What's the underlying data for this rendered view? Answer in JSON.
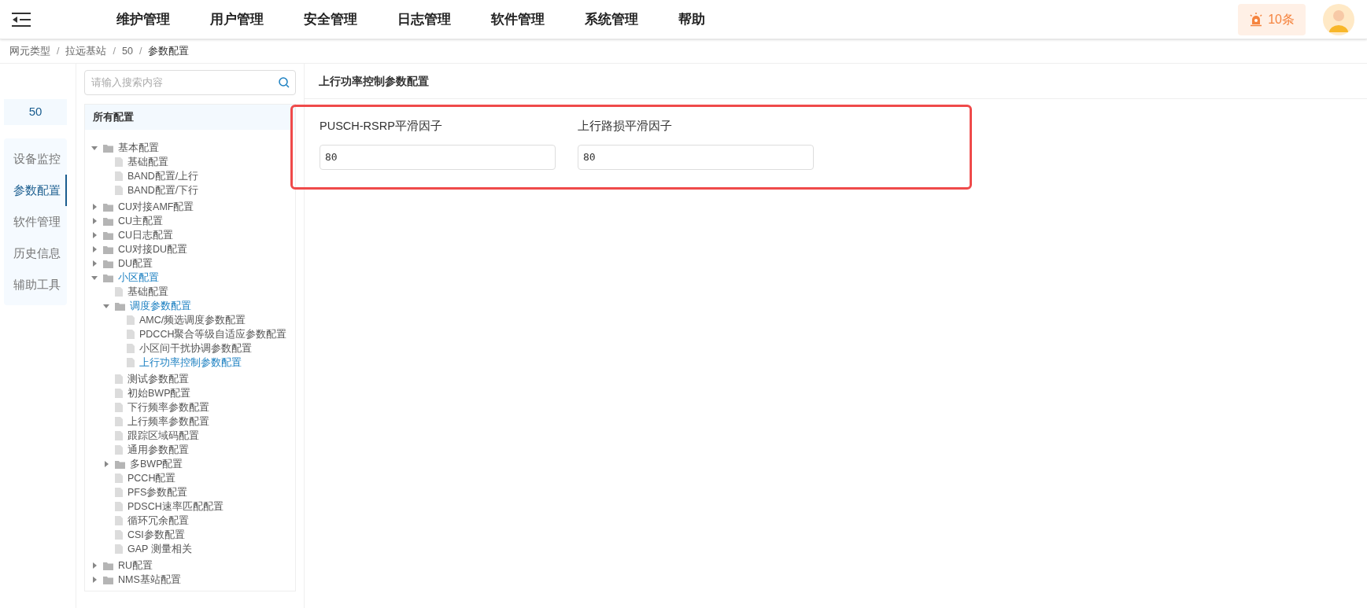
{
  "header": {
    "menu": [
      {
        "label": "维护管理"
      },
      {
        "label": "用户管理"
      },
      {
        "label": "安全管理"
      },
      {
        "label": "日志管理"
      },
      {
        "label": "软件管理"
      },
      {
        "label": "系统管理"
      },
      {
        "label": "帮助"
      }
    ],
    "alarm": "10条"
  },
  "breadcrumb": [
    {
      "label": "网元类型",
      "separator": "/"
    },
    {
      "label": "拉远基站",
      "separator": "/"
    },
    {
      "label": "50",
      "separator": "/"
    },
    {
      "label": "参数配置"
    }
  ],
  "side_nav": {
    "device": "50",
    "items": [
      {
        "label": "设备监控",
        "selected": false
      },
      {
        "label": "参数配置",
        "selected": true
      },
      {
        "label": "软件管理",
        "selected": false
      },
      {
        "label": "历史信息",
        "selected": false
      },
      {
        "label": "辅助工具",
        "selected": false
      }
    ]
  },
  "tree": {
    "search": {
      "placeholder": "请输入搜索内容"
    },
    "title": "所有配置",
    "items": [
      {
        "label": "基本配置",
        "kind": "folder",
        "expanded": true,
        "highlighted": false,
        "children": [
          {
            "label": "基础配置",
            "kind": "file",
            "highlighted": false
          },
          {
            "label": "BAND配置/上行",
            "kind": "file",
            "highlighted": false
          },
          {
            "label": "BAND配置/下行",
            "kind": "file",
            "highlighted": false
          }
        ]
      },
      {
        "label": "CU对接AMF配置",
        "kind": "folder",
        "expanded": false,
        "highlighted": false
      },
      {
        "label": "CU主配置",
        "kind": "folder",
        "expanded": false,
        "highlighted": false
      },
      {
        "label": "CU日志配置",
        "kind": "folder",
        "expanded": false,
        "highlighted": false
      },
      {
        "label": "CU对接DU配置",
        "kind": "folder",
        "expanded": false,
        "highlighted": false
      },
      {
        "label": "DU配置",
        "kind": "folder",
        "expanded": false,
        "highlighted": false
      },
      {
        "label": "小区配置",
        "kind": "folder",
        "expanded": true,
        "highlighted": true,
        "children": [
          {
            "label": "基础配置",
            "kind": "file",
            "highlighted": false
          },
          {
            "label": "调度参数配置",
            "kind": "folder",
            "expanded": true,
            "highlighted": true,
            "children": [
              {
                "label": "AMC/频选调度参数配置",
                "kind": "file",
                "highlighted": false
              },
              {
                "label": "PDCCH聚合等级自适应参数配置",
                "kind": "file",
                "highlighted": false
              },
              {
                "label": "小区间干扰协调参数配置",
                "kind": "file",
                "highlighted": false
              },
              {
                "label": "上行功率控制参数配置",
                "kind": "file",
                "highlighted": true
              }
            ]
          },
          {
            "label": "测试参数配置",
            "kind": "file",
            "highlighted": false
          },
          {
            "label": "初始BWP配置",
            "kind": "file",
            "highlighted": false
          },
          {
            "label": "下行频率参数配置",
            "kind": "file",
            "highlighted": false
          },
          {
            "label": "上行频率参数配置",
            "kind": "file",
            "highlighted": false
          },
          {
            "label": "跟踪区域码配置",
            "kind": "file",
            "highlighted": false
          },
          {
            "label": "通用参数配置",
            "kind": "file",
            "highlighted": false
          },
          {
            "label": "多BWP配置",
            "kind": "folder",
            "expanded": false,
            "highlighted": false
          },
          {
            "label": "PCCH配置",
            "kind": "file",
            "highlighted": false
          },
          {
            "label": "PFS参数配置",
            "kind": "file",
            "highlighted": false
          },
          {
            "label": "PDSCH速率匹配配置",
            "kind": "file",
            "highlighted": false
          },
          {
            "label": "循环冗余配置",
            "kind": "file",
            "highlighted": false
          },
          {
            "label": "CSI参数配置",
            "kind": "file",
            "highlighted": false
          },
          {
            "label": "GAP 测量相关",
            "kind": "file",
            "highlighted": false
          }
        ]
      },
      {
        "label": "RU配置",
        "kind": "folder",
        "expanded": false,
        "highlighted": false
      },
      {
        "label": "NMS基站配置",
        "kind": "folder",
        "expanded": false,
        "highlighted": false
      }
    ]
  },
  "panel": {
    "title": "上行功率控制参数配置",
    "fields": [
      {
        "label": "PUSCH-RSRP平滑因子",
        "value": "80"
      },
      {
        "label": "上行路损平滑因子",
        "value": "80"
      }
    ]
  }
}
